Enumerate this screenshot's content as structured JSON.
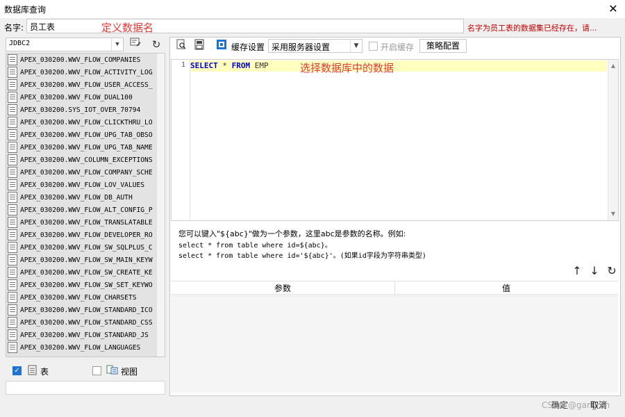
{
  "window": {
    "title": "数据库查询",
    "close_glyph": "✕"
  },
  "name_field": {
    "label": "名字:",
    "value": "员工表",
    "annotation": "定义数据名",
    "warning": "名字为员工表的数据集已经存在，请..."
  },
  "connection": {
    "value": "JDBC2"
  },
  "tables": [
    "APEX_030200.WWV_FLOW_COMPANIES",
    "APEX_030200.WWV_FLOW_ACTIVITY_LOG",
    "APEX_030200.WWV_FLOW_USER_ACCESS_",
    "APEX_030200.WWV_FLOW_DUAL100",
    "APEX_030200.SYS_IOT_OVER_70794",
    "APEX_030200.WWV_FLOW_CLICKTHRU_LO",
    "APEX_030200.WWV_FLOW_UPG_TAB_OBSO",
    "APEX_030200.WWV_FLOW_UPG_TAB_NAME",
    "APEX_030200.WWV_COLUMN_EXCEPTIONS",
    "APEX_030200.WWV_FLOW_COMPANY_SCHE",
    "APEX_030200.WWV_FLOW_LOV_VALUES",
    "APEX_030200.WWV_FLOW_DB_AUTH",
    "APEX_030200.WWV_FLOW_ALT_CONFIG_P",
    "APEX_030200.WWV_FLOW_TRANSLATABLE",
    "APEX_030200.WWV_FLOW_DEVELOPER_RO",
    "APEX_030200.WWV_FLOW_SW_SQLPLUS_C",
    "APEX_030200.WWV_FLOW_SW_MAIN_KEYW",
    "APEX_030200.WWV_FLOW_SW_CREATE_KE",
    "APEX_030200.WWV_FLOW_SW_SET_KEYWO",
    "APEX_030200.WWV_FLOW_CHARSETS",
    "APEX_030200.WWV_FLOW_STANDARD_ICO",
    "APEX_030200.WWV_FLOW_STANDARD_CSS",
    "APEX_030200.WWV_FLOW_STANDARD_JS",
    "APEX_030200.WWV_FLOW_LANGUAGES"
  ],
  "filters": {
    "table_label": "表",
    "table_checked": true,
    "view_label": "视图",
    "view_checked": false
  },
  "toolbar": {
    "cache_label": "缓存设置",
    "cache_value": "采用服务器设置",
    "enable_cache_label": "开启缓存",
    "policy_button": "策略配置"
  },
  "editor": {
    "line_number": "1",
    "kw_select": "SELECT",
    "star": " * ",
    "kw_from": "FROM",
    "table_name": " EMP",
    "annotation": "选择数据库中的数据"
  },
  "help": {
    "line1": "您可以键入\"${abc}\"做为一个参数，这里abc是参数的名称。例如:",
    "line2": "select * from table where id=${abc}。",
    "line3": "select * from table where id='${abc}'。(如果id字段为字符串类型)"
  },
  "params_table": {
    "col_param": "参数",
    "col_value": "值"
  },
  "footer": {
    "ok": "确定",
    "cancel": "取消",
    "watermark": "CSDN @gan_ren"
  },
  "colors": {
    "accent": "#1e73d0",
    "annotation": "#e53935",
    "warning": "#c00000",
    "keyword": "#0000cc",
    "highlight": "#ffffc0"
  }
}
